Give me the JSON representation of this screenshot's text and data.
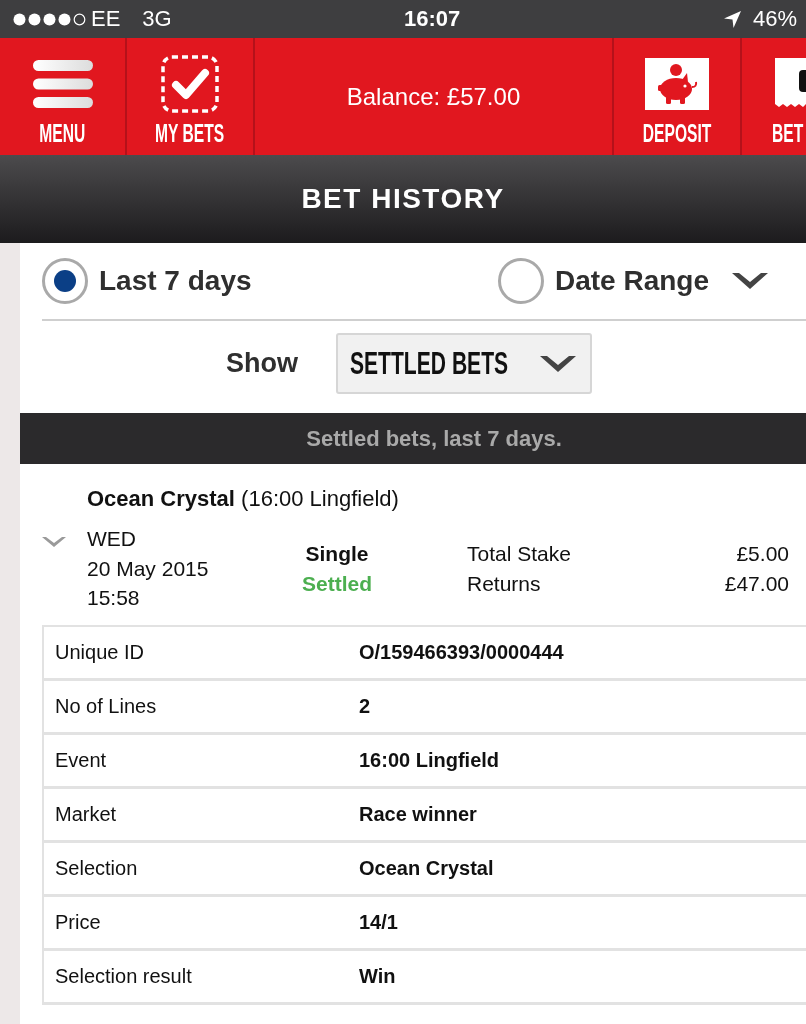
{
  "status_bar": {
    "carrier": "EE",
    "network": "3G",
    "time": "16:07",
    "battery": "46%"
  },
  "header": {
    "left_buttons": [
      {
        "kind": "menu",
        "label": "MENU"
      },
      {
        "kind": "my_bets",
        "label": "MY BETS"
      }
    ],
    "balance": "Balance: £57.00",
    "right_buttons": [
      {
        "kind": "deposit",
        "label": "DEPOSIT"
      },
      {
        "kind": "bet_slip",
        "label": "BET"
      }
    ]
  },
  "title_bar": {
    "title": "BET HISTORY"
  },
  "filters": {
    "periods": [
      {
        "label": "Last 7 days",
        "selected": true
      },
      {
        "label": "Date Range",
        "selected": false
      }
    ],
    "show": {
      "label": "Show",
      "value": "SETTLED BETS"
    }
  },
  "banner": {
    "text": "Settled bets, last 7 days."
  },
  "bet": {
    "title": "**Ocean Crystal** (16:00 Lingfield)",
    "day": "WED",
    "date": "20 May 2015",
    "time": "15:58",
    "type": "Single",
    "status": "Settled",
    "totals": [
      {
        "label": "Total Stake",
        "value": "£5.00"
      },
      {
        "label": "Returns",
        "value": "£47.00"
      }
    ],
    "details": [
      {
        "label": "Unique ID",
        "value": "O/159466393/0000444"
      },
      {
        "label": "No of Lines",
        "value": "2"
      },
      {
        "label": "Event",
        "value": "16:00 Lingfield"
      },
      {
        "label": "Market",
        "value": "Race winner"
      },
      {
        "label": "Selection",
        "value": "Ocean Crystal"
      },
      {
        "label": "Price",
        "value": "14/1"
      },
      {
        "label": "Selection result",
        "value": "Win"
      }
    ]
  }
}
